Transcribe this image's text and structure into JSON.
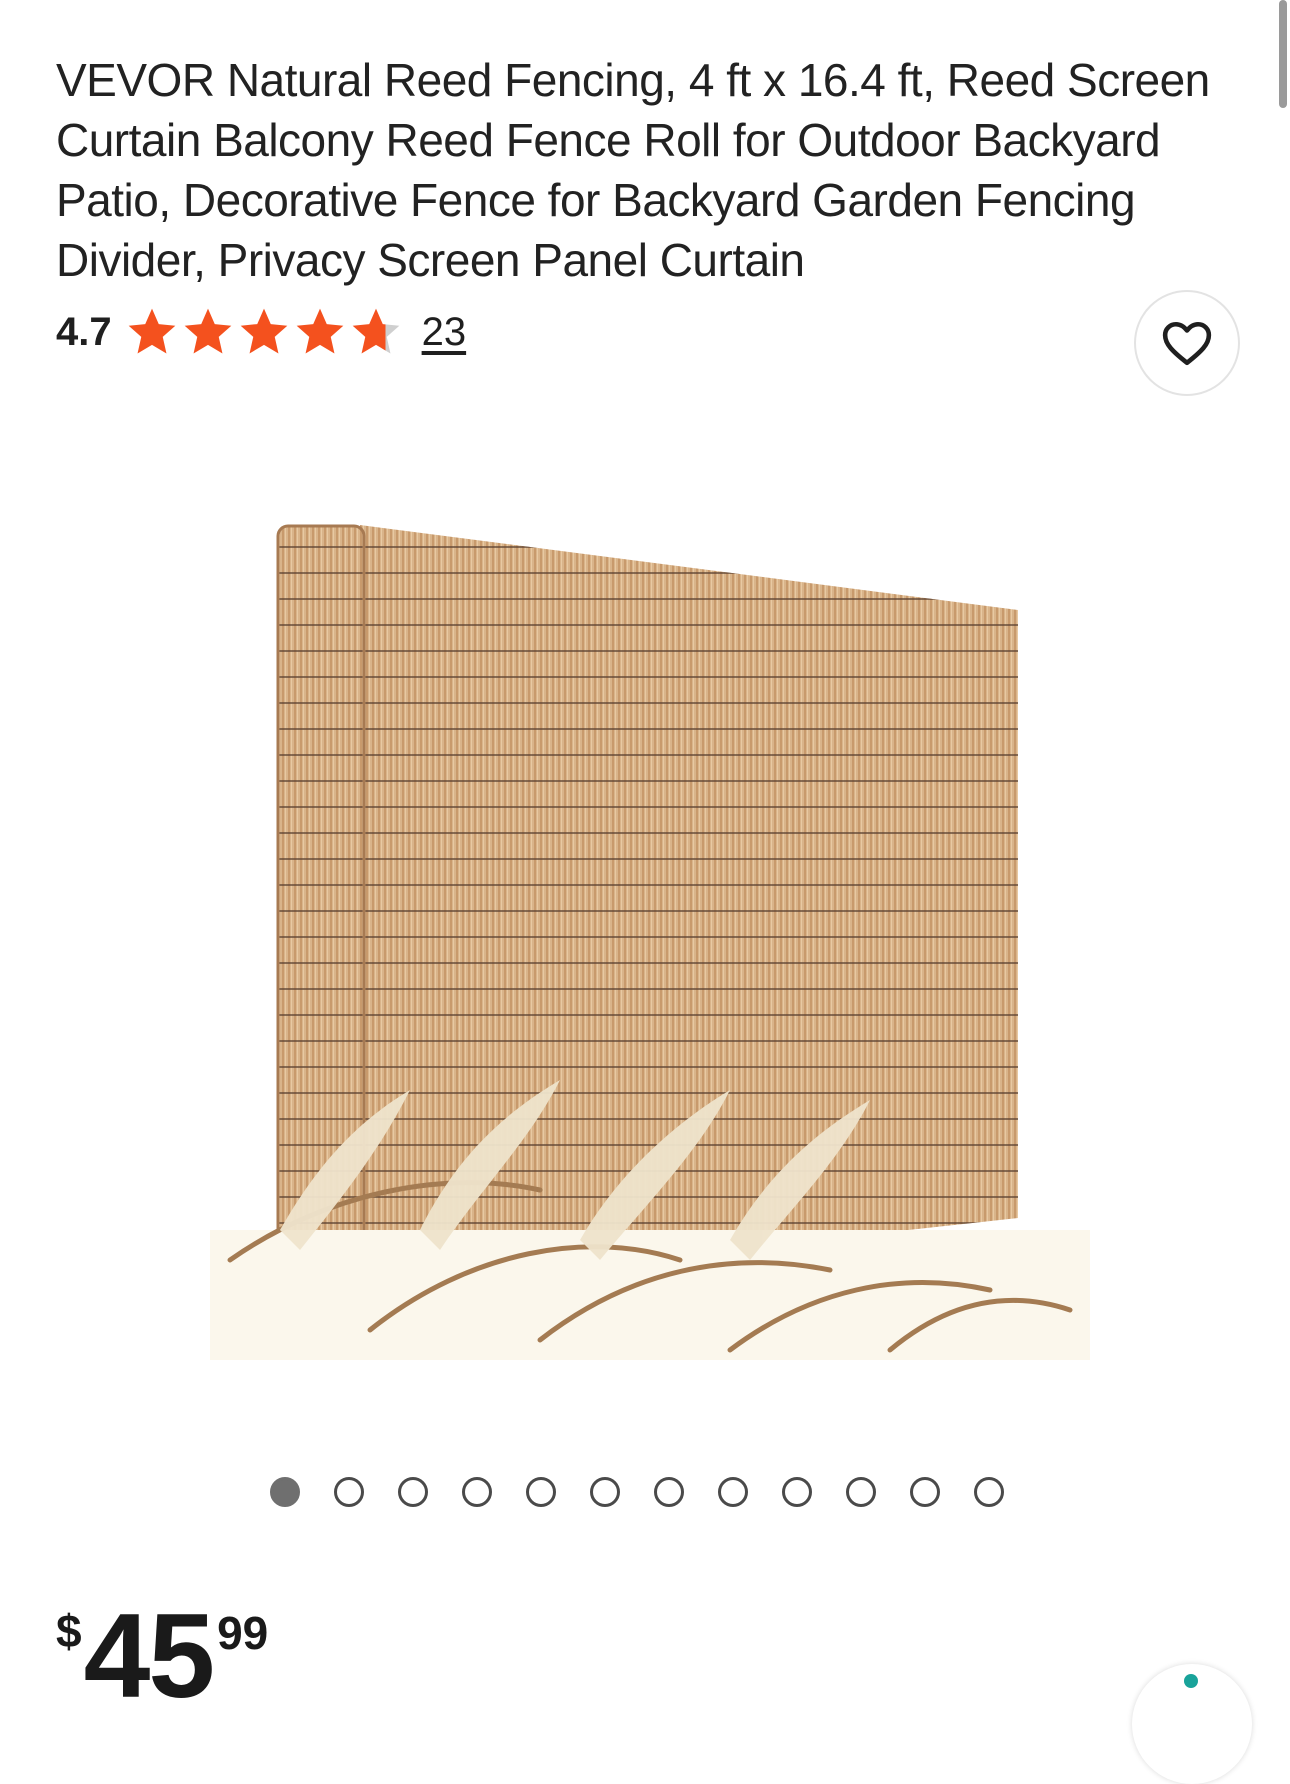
{
  "product": {
    "title": "VEVOR Natural Reed Fencing, 4 ft x 16.4 ft, Reed Screen Curtain Balcony Reed Fence Roll for Outdoor Backyard Patio, Decorative Fence for Backyard Garden Fencing Divider, Privacy Screen Panel Curtain"
  },
  "rating": {
    "value": "4.7",
    "stars_filled": 4.7,
    "stars_total": 5,
    "count": "23",
    "star_color": "#f4511e",
    "star_empty_color": "#cfcfcf"
  },
  "favorite": {
    "icon": "heart-outline-icon"
  },
  "gallery": {
    "image_icon": "reed-fence-roll-image",
    "dots_total": 12,
    "active_index": 0
  },
  "price": {
    "currency": "$",
    "dollars": "45",
    "cents": "99"
  },
  "floating_button": {
    "icon": "chat-icon",
    "accent": "#19a39a"
  }
}
